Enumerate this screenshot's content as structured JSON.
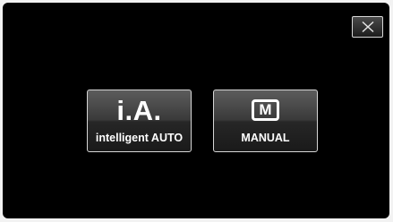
{
  "close_button": {
    "icon": "close-icon"
  },
  "modes": {
    "intelligent_auto": {
      "logo": "i.A.",
      "label": "intelligent AUTO"
    },
    "manual": {
      "icon_letter": "M",
      "label": "MANUAL"
    }
  },
  "colors": {
    "background": "#000000",
    "button_border": "#d6d6d6",
    "text": "#ffffff"
  }
}
